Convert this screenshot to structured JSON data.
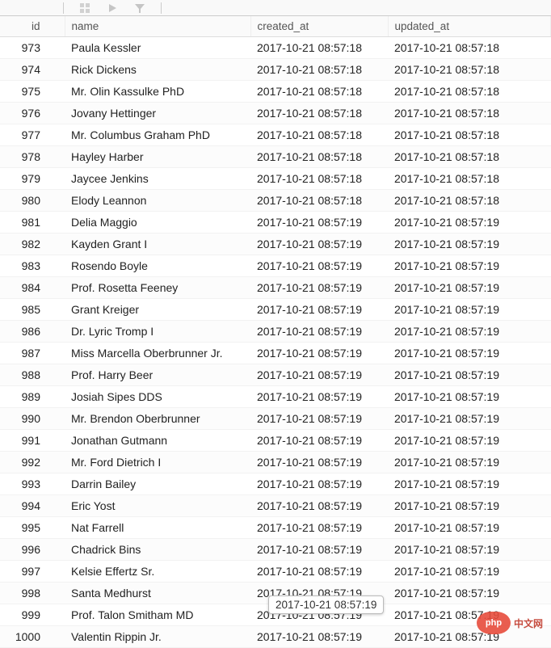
{
  "columns": {
    "id": "id",
    "name": "name",
    "created_at": "created_at",
    "updated_at": "updated_at"
  },
  "tooltip": "2017-10-21 08:57:19",
  "watermark": {
    "logo": "php",
    "text": "中文网"
  },
  "rows": [
    {
      "id": "973",
      "name": "Paula Kessler",
      "created_at": "2017-10-21 08:57:18",
      "updated_at": "2017-10-21 08:57:18"
    },
    {
      "id": "974",
      "name": "Rick Dickens",
      "created_at": "2017-10-21 08:57:18",
      "updated_at": "2017-10-21 08:57:18"
    },
    {
      "id": "975",
      "name": "Mr. Olin Kassulke PhD",
      "created_at": "2017-10-21 08:57:18",
      "updated_at": "2017-10-21 08:57:18"
    },
    {
      "id": "976",
      "name": "Jovany Hettinger",
      "created_at": "2017-10-21 08:57:18",
      "updated_at": "2017-10-21 08:57:18"
    },
    {
      "id": "977",
      "name": "Mr. Columbus Graham PhD",
      "created_at": "2017-10-21 08:57:18",
      "updated_at": "2017-10-21 08:57:18"
    },
    {
      "id": "978",
      "name": "Hayley Harber",
      "created_at": "2017-10-21 08:57:18",
      "updated_at": "2017-10-21 08:57:18"
    },
    {
      "id": "979",
      "name": "Jaycee Jenkins",
      "created_at": "2017-10-21 08:57:18",
      "updated_at": "2017-10-21 08:57:18"
    },
    {
      "id": "980",
      "name": "Elody Leannon",
      "created_at": "2017-10-21 08:57:18",
      "updated_at": "2017-10-21 08:57:18"
    },
    {
      "id": "981",
      "name": "Delia Maggio",
      "created_at": "2017-10-21 08:57:19",
      "updated_at": "2017-10-21 08:57:19"
    },
    {
      "id": "982",
      "name": "Kayden Grant I",
      "created_at": "2017-10-21 08:57:19",
      "updated_at": "2017-10-21 08:57:19"
    },
    {
      "id": "983",
      "name": "Rosendo Boyle",
      "created_at": "2017-10-21 08:57:19",
      "updated_at": "2017-10-21 08:57:19"
    },
    {
      "id": "984",
      "name": "Prof. Rosetta Feeney",
      "created_at": "2017-10-21 08:57:19",
      "updated_at": "2017-10-21 08:57:19"
    },
    {
      "id": "985",
      "name": "Grant Kreiger",
      "created_at": "2017-10-21 08:57:19",
      "updated_at": "2017-10-21 08:57:19"
    },
    {
      "id": "986",
      "name": "Dr. Lyric Tromp I",
      "created_at": "2017-10-21 08:57:19",
      "updated_at": "2017-10-21 08:57:19"
    },
    {
      "id": "987",
      "name": "Miss Marcella Oberbrunner Jr.",
      "created_at": "2017-10-21 08:57:19",
      "updated_at": "2017-10-21 08:57:19"
    },
    {
      "id": "988",
      "name": "Prof. Harry Beer",
      "created_at": "2017-10-21 08:57:19",
      "updated_at": "2017-10-21 08:57:19"
    },
    {
      "id": "989",
      "name": "Josiah Sipes DDS",
      "created_at": "2017-10-21 08:57:19",
      "updated_at": "2017-10-21 08:57:19"
    },
    {
      "id": "990",
      "name": "Mr. Brendon Oberbrunner",
      "created_at": "2017-10-21 08:57:19",
      "updated_at": "2017-10-21 08:57:19"
    },
    {
      "id": "991",
      "name": "Jonathan Gutmann",
      "created_at": "2017-10-21 08:57:19",
      "updated_at": "2017-10-21 08:57:19"
    },
    {
      "id": "992",
      "name": "Mr. Ford Dietrich I",
      "created_at": "2017-10-21 08:57:19",
      "updated_at": "2017-10-21 08:57:19"
    },
    {
      "id": "993",
      "name": "Darrin Bailey",
      "created_at": "2017-10-21 08:57:19",
      "updated_at": "2017-10-21 08:57:19"
    },
    {
      "id": "994",
      "name": "Eric Yost",
      "created_at": "2017-10-21 08:57:19",
      "updated_at": "2017-10-21 08:57:19"
    },
    {
      "id": "995",
      "name": "Nat Farrell",
      "created_at": "2017-10-21 08:57:19",
      "updated_at": "2017-10-21 08:57:19"
    },
    {
      "id": "996",
      "name": "Chadrick Bins",
      "created_at": "2017-10-21 08:57:19",
      "updated_at": "2017-10-21 08:57:19"
    },
    {
      "id": "997",
      "name": "Kelsie Effertz Sr.",
      "created_at": "2017-10-21 08:57:19",
      "updated_at": "2017-10-21 08:57:19"
    },
    {
      "id": "998",
      "name": "Santa Medhurst",
      "created_at": "2017-10-21 08:57:19",
      "updated_at": "2017-10-21 08:57:19"
    },
    {
      "id": "999",
      "name": "Prof. Talon Smitham MD",
      "created_at": "2017-10-21 08:57:19",
      "updated_at": "2017-10-21 08:57:19"
    },
    {
      "id": "1000",
      "name": "Valentin Rippin Jr.",
      "created_at": "2017-10-21 08:57:19",
      "updated_at": "2017-10-21 08:57:19"
    }
  ]
}
